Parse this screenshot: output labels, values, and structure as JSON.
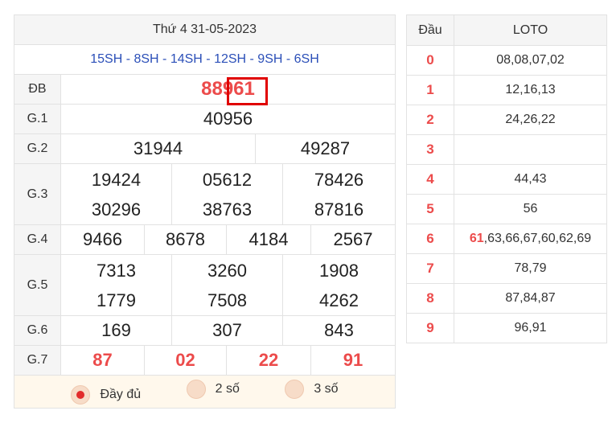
{
  "header": {
    "date": "Thứ 4 31-05-2023"
  },
  "codes": "15SH - 8SH - 14SH - 12SH - 9SH - 6SH",
  "prizes": {
    "db": {
      "label": "ĐB",
      "value": "88961"
    },
    "g1": {
      "label": "G.1",
      "values": [
        "40956"
      ]
    },
    "g2": {
      "label": "G.2",
      "values": [
        "31944",
        "49287"
      ]
    },
    "g3": {
      "label": "G.3",
      "values": [
        "19424",
        "05612",
        "78426",
        "30296",
        "38763",
        "87816"
      ]
    },
    "g4": {
      "label": "G.4",
      "values": [
        "9466",
        "8678",
        "4184",
        "2567"
      ]
    },
    "g5": {
      "label": "G.5",
      "values": [
        "7313",
        "3260",
        "1908",
        "1779",
        "7508",
        "4262"
      ]
    },
    "g6": {
      "label": "G.6",
      "values": [
        "169",
        "307",
        "843"
      ]
    },
    "g7": {
      "label": "G.7",
      "values": [
        "87",
        "02",
        "22",
        "91"
      ]
    }
  },
  "options": [
    {
      "label": "Đầy đủ",
      "selected": true
    },
    {
      "label": "2 số",
      "selected": false
    },
    {
      "label": "3 số",
      "selected": false
    }
  ],
  "loto": {
    "head_label": "Đầu",
    "loto_label": "LOTO",
    "rows": [
      {
        "head": "0",
        "values": "08,08,07,02"
      },
      {
        "head": "1",
        "values": "12,16,13"
      },
      {
        "head": "2",
        "values": "24,26,22"
      },
      {
        "head": "3",
        "values": ""
      },
      {
        "head": "4",
        "values": "44,43"
      },
      {
        "head": "5",
        "values": "56"
      },
      {
        "head": "6",
        "highlight": "61",
        "values": ",63,66,67,60,62,69"
      },
      {
        "head": "7",
        "values": "78,79"
      },
      {
        "head": "8",
        "values": "87,84,87"
      },
      {
        "head": "9",
        "values": "96,91"
      }
    ]
  },
  "colors": {
    "accent_red": "#ec4b4b",
    "code_blue": "#2b4fb8",
    "highlight_box": "#e00000"
  }
}
